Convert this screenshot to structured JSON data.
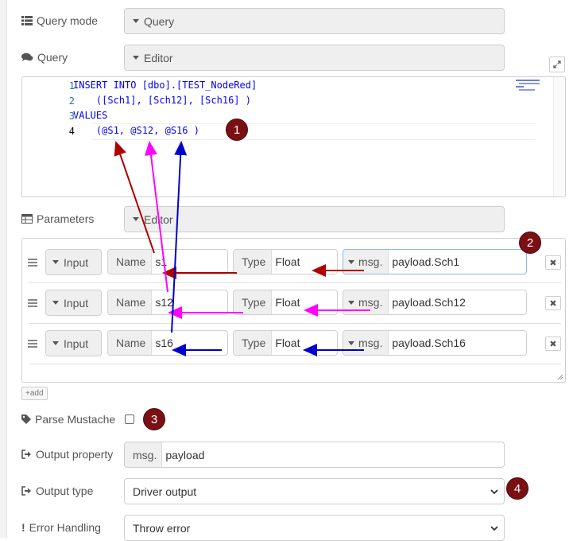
{
  "query_mode": {
    "label": "Query mode",
    "value": "Query",
    "icon": "list-icon"
  },
  "query": {
    "label": "Query",
    "editor_value": "Editor",
    "icon": "comments-icon",
    "lines": [
      {
        "num": "1",
        "text": "INSERT INTO [dbo].[TEST_NodeRed]"
      },
      {
        "num": "2",
        "text": "    ([Sch1], [Sch12], [Sch16] )"
      },
      {
        "num": "3",
        "text": "VALUES"
      },
      {
        "num": "4",
        "text": "    (@S1, @S12, @S16 )"
      }
    ]
  },
  "parameters": {
    "label": "Parameters",
    "editor_value": "Editor",
    "icon": "table-icon",
    "name_label": "Name",
    "type_label": "Type",
    "msg_prefix": "msg.",
    "rows": [
      {
        "direction": "Input",
        "name": "s1",
        "type": "Float",
        "value": "payload.Sch1"
      },
      {
        "direction": "Input",
        "name": "s12",
        "type": "Float",
        "value": "payload.Sch12"
      },
      {
        "direction": "Input",
        "name": "s16",
        "type": "Float",
        "value": "payload.Sch16"
      }
    ],
    "add_label": "add"
  },
  "parse_mustache": {
    "label": "Parse Mustache",
    "checked": false,
    "icon": "tag-icon"
  },
  "output_property": {
    "label": "Output property",
    "prefix": "msg.",
    "value": "payload",
    "icon": "sign-out-icon"
  },
  "output_type": {
    "label": "Output type",
    "value": "Driver output",
    "icon": "sign-out-icon"
  },
  "error_handling": {
    "label": "Error Handling",
    "value": "Throw error",
    "icon": "exclamation-icon"
  },
  "badges": [
    "1",
    "2",
    "3",
    "4"
  ],
  "colors": {
    "arrow_dark_red": "#b00000",
    "arrow_magenta": "#ff00ff",
    "arrow_blue": "#0000c8",
    "badge": "#7a0f14"
  }
}
